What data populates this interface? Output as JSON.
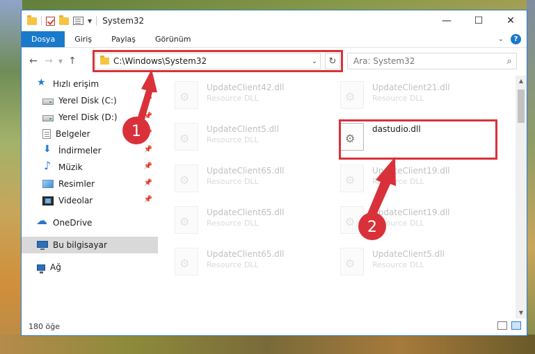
{
  "window": {
    "title": "System32",
    "buttons": {
      "minimize": "—",
      "maximize": "☐",
      "close": "✕"
    }
  },
  "ribbon": {
    "tabs": [
      {
        "label": "Dosya",
        "active": true
      },
      {
        "label": "Giriş",
        "active": false
      },
      {
        "label": "Paylaş",
        "active": false
      },
      {
        "label": "Görünüm",
        "active": false
      }
    ],
    "help": "?"
  },
  "navigation": {
    "back": "←",
    "forward": "→",
    "up": "↑",
    "address": "C:\\Windows\\System32",
    "search_placeholder": "Ara: System32"
  },
  "sidebar": {
    "quick_access": "Hızlı erişim",
    "pinned": [
      {
        "label": "Yerel Disk (C:)",
        "icon": "disk-icon"
      },
      {
        "label": "Yerel Disk (D:)",
        "icon": "disk-icon"
      },
      {
        "label": "Belgeler",
        "icon": "documents-icon"
      },
      {
        "label": "İndirmeler",
        "icon": "downloads-icon"
      },
      {
        "label": "Müzik",
        "icon": "music-icon"
      },
      {
        "label": "Resimler",
        "icon": "pictures-icon"
      },
      {
        "label": "Videolar",
        "icon": "videos-icon"
      }
    ],
    "onedrive": "OneDrive",
    "this_pc": "Bu bilgisayar",
    "network": "Ağ"
  },
  "files": [
    {
      "name": "UpdateClient42.dll",
      "type": "Resource DLL",
      "faded": true
    },
    {
      "name": "UpdateClient21.dll",
      "type": "Resource DLL",
      "faded": true
    },
    {
      "name": "UpdateClient5.dll",
      "type": "Resource DLL",
      "faded": true
    },
    {
      "name": "dastudio.dll",
      "type": "",
      "faded": false
    },
    {
      "name": "UpdateClient65.dll",
      "type": "Resource DLL",
      "faded": true
    },
    {
      "name": "UpdateClient19.dll",
      "type": "Resource DLL",
      "faded": true
    },
    {
      "name": "UpdateClient65.dll",
      "type": "Resource DLL",
      "faded": true
    },
    {
      "name": "UpdateClient19.dll",
      "type": "Resource DLL",
      "faded": true
    },
    {
      "name": "UpdateClient65.dll",
      "type": "Resource DLL",
      "faded": true
    },
    {
      "name": "UpdateClient5.dll",
      "type": "Resource DLL",
      "faded": true
    }
  ],
  "status": {
    "count": "180 öğe"
  },
  "annotations": {
    "step1": "1",
    "step2": "2",
    "color": "#d9313a"
  }
}
